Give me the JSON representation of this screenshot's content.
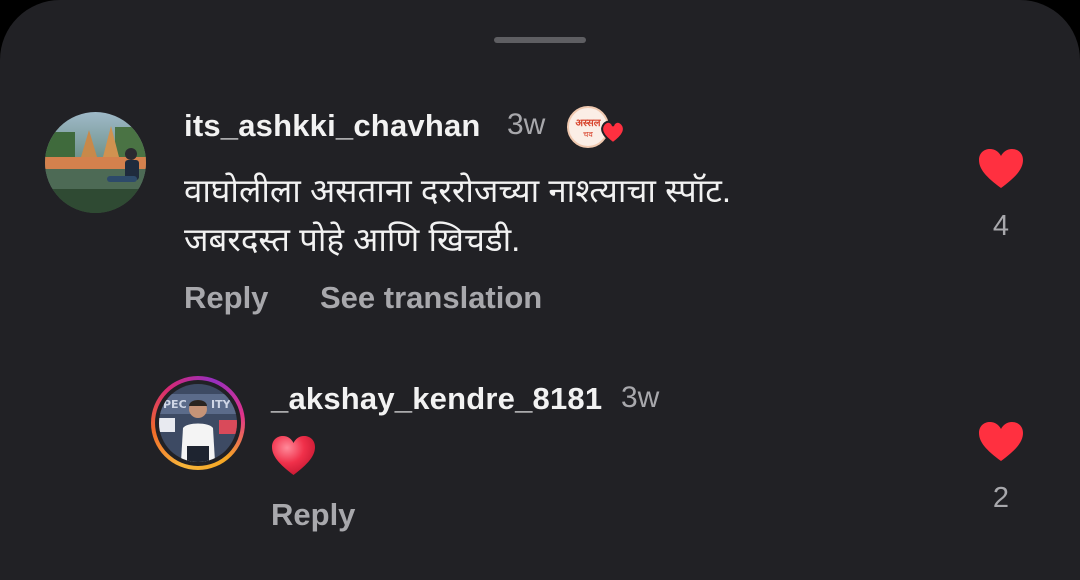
{
  "comments": [
    {
      "username": "its_ashkki_chavhan",
      "time": "3w",
      "text_lines": [
        "वाघोलीला असताना दररोजच्या नाश्त्याचा स्पॉट.",
        "जबरदस्त पोहे आणि खिचडी."
      ],
      "reply_label": "Reply",
      "translate_label": "See translation",
      "like_count": "4",
      "avatar_icon": "user-avatar-temple-photo",
      "badge_icon": "creator-liked-badge-icon",
      "liked": true
    },
    {
      "username": "_akshay_kendre_8181",
      "time": "3w",
      "emoji_icon": "red-heart-emoji",
      "reply_label": "Reply",
      "like_count": "2",
      "avatar_icon": "user-avatar-with-story-ring",
      "liked": true
    }
  ],
  "colors": {
    "background": "#212125",
    "text_primary": "#f2f2f2",
    "text_secondary": "#a8a8ac",
    "like_red": "#ff3040"
  }
}
